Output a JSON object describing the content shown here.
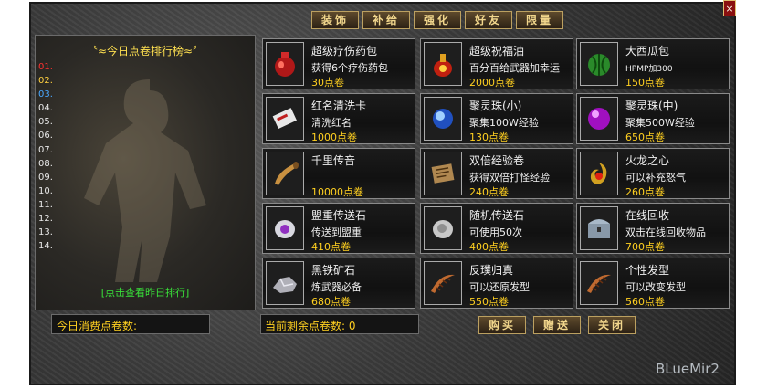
{
  "tabs": [
    "装饰",
    "补给",
    "强化",
    "好友",
    "限量"
  ],
  "close_label": "×",
  "ranking": {
    "title": "〝≈今日点卷排行榜≈〞",
    "ranks": [
      "01.",
      "02.",
      "03.",
      "04.",
      "05.",
      "06.",
      "07.",
      "08.",
      "09.",
      "10.",
      "11.",
      "12.",
      "13.",
      "14."
    ],
    "view_yesterday_link": "[点击查看昨日排行]"
  },
  "items": [
    {
      "name": "超级疗伤药包",
      "desc": "获得6个疗伤药包",
      "price": "30点卷",
      "icon": "red-vase-icon"
    },
    {
      "name": "超级祝福油",
      "desc": "百分百给武器加幸运",
      "price": "2000点卷",
      "icon": "blessing-oil-icon"
    },
    {
      "name": "大西瓜包",
      "desc": "HPMP加300",
      "price": "150点卷",
      "icon": "watermelon-icon"
    },
    {
      "name": "红名清洗卡",
      "desc": "清洗红名",
      "price": "1000点卷",
      "icon": "card-icon"
    },
    {
      "name": "聚灵珠(小)",
      "desc": "聚集100W经验",
      "price": "130点卷",
      "icon": "blue-orb-icon"
    },
    {
      "name": "聚灵珠(中)",
      "desc": "聚集500W经验",
      "price": "650点卷",
      "icon": "purple-orb-icon"
    },
    {
      "name": "千里传音",
      "desc": "",
      "price": "10000点卷",
      "icon": "horn-icon"
    },
    {
      "name": "双倍经验卷",
      "desc": "获得双倍打怪经验",
      "price": "240点卷",
      "icon": "scroll-book-icon"
    },
    {
      "name": "火龙之心",
      "desc": "可以补充怒气",
      "price": "260点卷",
      "icon": "fire-dragon-heart-icon"
    },
    {
      "name": "盟重传送石",
      "desc": "传送到盟重",
      "price": "410点卷",
      "icon": "purple-stone-icon"
    },
    {
      "name": "随机传送石",
      "desc": "可使用50次",
      "price": "400点卷",
      "icon": "gray-stone-icon"
    },
    {
      "name": "在线回收",
      "desc": "双击在线回收物品",
      "price": "700点卷",
      "icon": "treasure-chest-icon"
    },
    {
      "name": "黑铁矿石",
      "desc": "炼武器必备",
      "price": "680点卷",
      "icon": "ore-icon"
    },
    {
      "name": "反璞归真",
      "desc": "可以还原发型",
      "price": "550点卷",
      "icon": "comb-icon"
    },
    {
      "name": "个性发型",
      "desc": "可以改变发型",
      "price": "560点卷",
      "icon": "comb-icon"
    }
  ],
  "stats": {
    "today_spent_label": "今日消费点卷数:",
    "remaining_label": "当前剩余点卷数: 0"
  },
  "buttons": {
    "buy": "购买",
    "gift": "赠送",
    "close": "关闭"
  },
  "watermark": "BLueMir2"
}
